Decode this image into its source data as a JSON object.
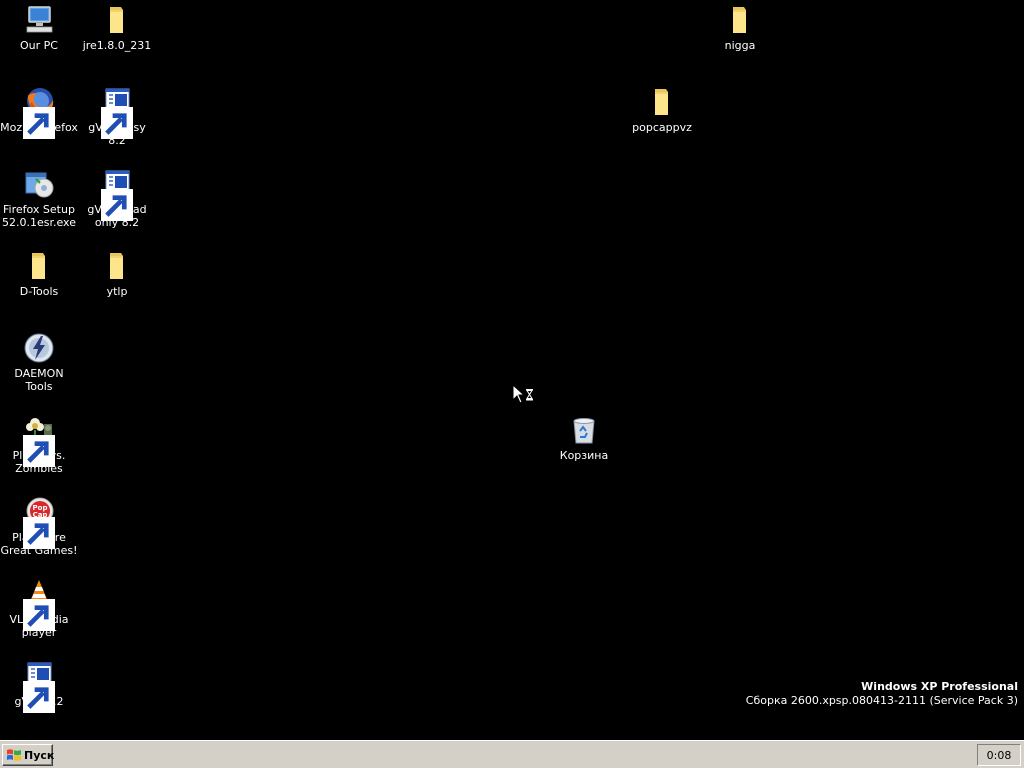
{
  "desktop": {
    "icons": {
      "our_pc": "Our PC",
      "firefox": "Mozilla Firefox",
      "firefox_setup": "Firefox Setup 52.0.1esr.exe",
      "d_tools": "D-Tools",
      "daemon_tools": "DAEMON Tools",
      "pvz": "Plants vs. Zombies",
      "play_more": "Play More Great Games!",
      "vlc": "VLC media player",
      "gvim": "gVim 8.2",
      "jre": "jre1.8.0_231",
      "gvim_easy": "gVim Easy 8.2",
      "gvim_readonly": "gVim Read only 8.2",
      "ytlp": "ytlp",
      "nigga": "nigga",
      "popcappvz": "popcappvz",
      "recycle_bin": "Корзина"
    },
    "watermark": {
      "title": "Windows XP Professional",
      "build": "Сборка 2600.xpsp.080413-2111 (Service Pack 3)"
    }
  },
  "taskbar": {
    "start_label": "Пуск",
    "clock": "0:08"
  },
  "colors": {
    "desktop_bg": "#000000",
    "taskbar_bg": "#d4d0c8",
    "label_text": "#ffffff"
  }
}
